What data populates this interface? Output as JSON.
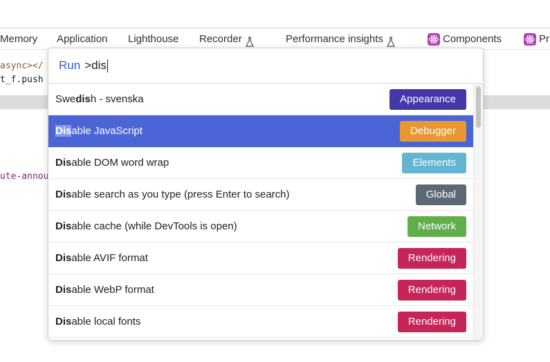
{
  "tabs": [
    {
      "label": "Memory",
      "icon": null
    },
    {
      "label": "Application",
      "icon": null
    },
    {
      "label": "Lighthouse",
      "icon": null
    },
    {
      "label": "Recorder",
      "icon": "flask-icon"
    },
    {
      "label": "Performance insights",
      "icon": "flask-icon"
    },
    {
      "label": "Components",
      "icon": "react-icon"
    },
    {
      "label": "Pr",
      "icon": "react-icon"
    }
  ],
  "code": {
    "line1": "async></",
    "line2": "t_f.push",
    "line3": "ute-annou"
  },
  "palette": {
    "prompt_label": "Run",
    "input_value": ">dis",
    "items": [
      {
        "pre": "Swe",
        "match": "dis",
        "post": "h - svenska",
        "category": "Appearance",
        "color": "#4437a8"
      },
      {
        "pre": "",
        "match": "Dis",
        "post": "able JavaScript",
        "category": "Debugger",
        "color": "#e89732"
      },
      {
        "pre": "",
        "match": "Dis",
        "post": "able DOM word wrap",
        "category": "Elements",
        "color": "#63b5d1"
      },
      {
        "pre": "",
        "match": "Dis",
        "post": "able search as you type (press Enter to search)",
        "category": "Global",
        "color": "#5c6874"
      },
      {
        "pre": "",
        "match": "Dis",
        "post": "able cache (while DevTools is open)",
        "category": "Network",
        "color": "#62ad4c"
      },
      {
        "pre": "",
        "match": "Dis",
        "post": "able AVIF format",
        "category": "Rendering",
        "color": "#c62557"
      },
      {
        "pre": "",
        "match": "Dis",
        "post": "able WebP format",
        "category": "Rendering",
        "color": "#c62557"
      },
      {
        "pre": "",
        "match": "Dis",
        "post": "able local fonts",
        "category": "Rendering",
        "color": "#c62557"
      }
    ],
    "selected_index": 1
  }
}
